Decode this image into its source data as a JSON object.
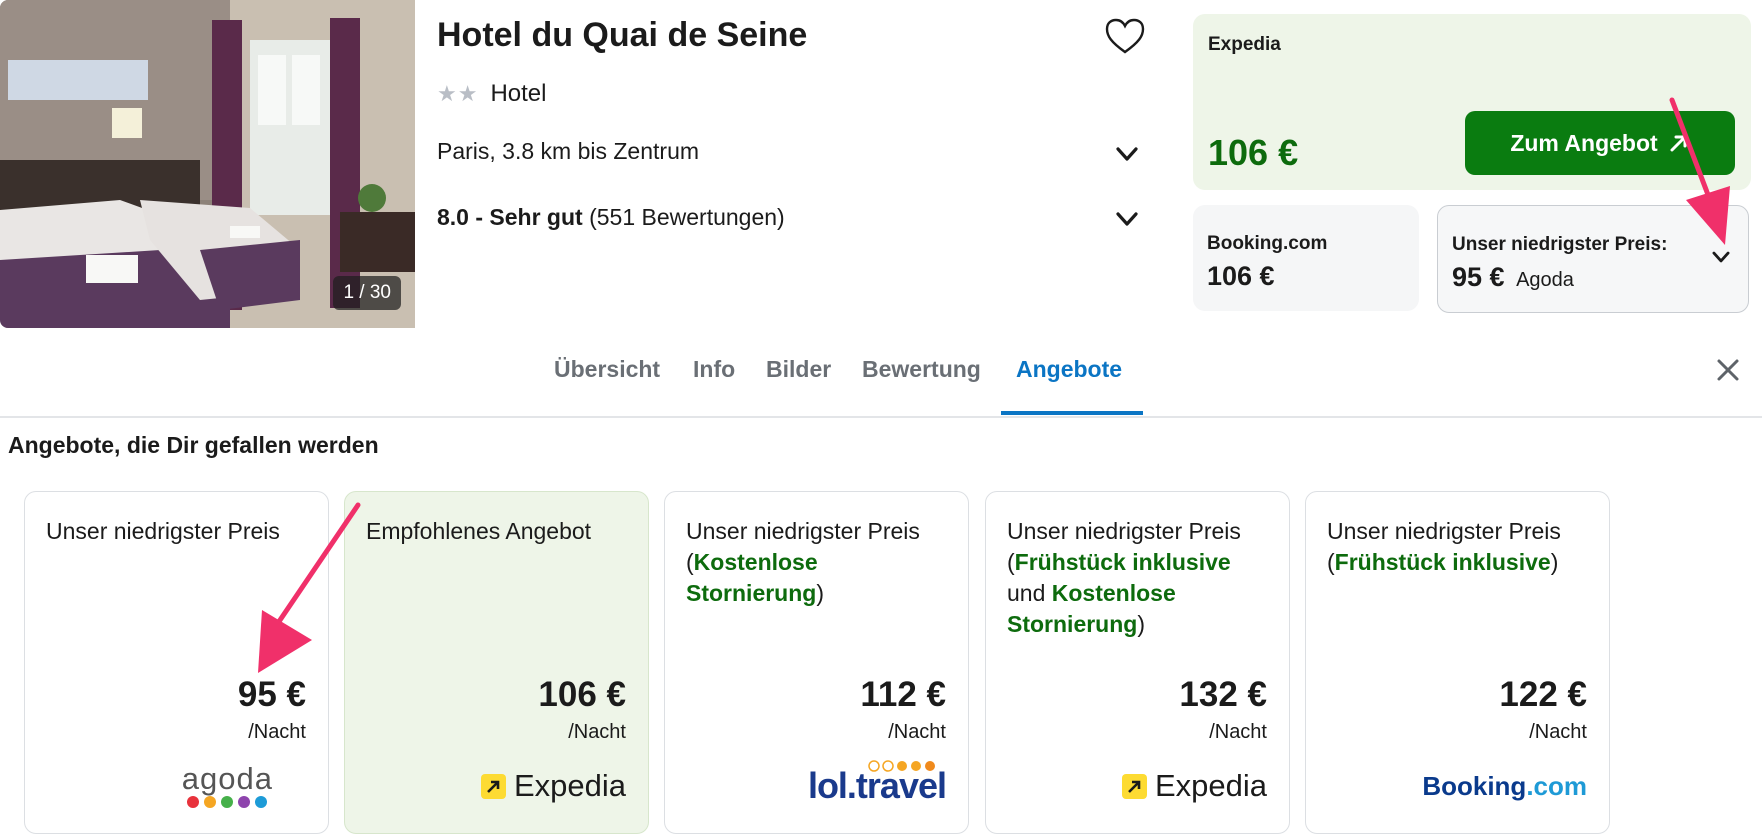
{
  "header": {
    "hotel_name": "Hotel du Quai de Seine",
    "stars": "★★",
    "type": "Hotel",
    "location": "Paris, 3.8 km bis Zentrum",
    "rating_score": "8.0 - Sehr gut",
    "rating_count": "(551 Bewertungen)",
    "photo_counter": "1 / 30"
  },
  "main_deal": {
    "provider": "Expedia",
    "price": "106 €",
    "button_label": "Zum Angebot",
    "button_icon": "external-arrow-icon"
  },
  "side_deals": [
    {
      "label": "Booking.com",
      "price": "106 €"
    },
    {
      "label": "Unser niedrigster Preis:",
      "price": "95 €",
      "provider": "Agoda"
    }
  ],
  "tabs": [
    {
      "label": "Übersicht"
    },
    {
      "label": "Info"
    },
    {
      "label": "Bilder"
    },
    {
      "label": "Bewertung"
    },
    {
      "label": "Angebote",
      "active": true
    }
  ],
  "section_title": "Angebote, die Dir gefallen werden",
  "cards": [
    {
      "title": "Unser niedrigster Preis",
      "price": "95 €",
      "per_night": "/Nacht",
      "provider_logo": "agoda"
    },
    {
      "title": "Empfohlenes Angebot",
      "price": "106 €",
      "per_night": "/Nacht",
      "provider_logo": "Expedia"
    },
    {
      "title_prefix": "Unser niedrigster Preis",
      "highlight_1": "Kostenlose Stornierung",
      "price": "112 €",
      "per_night": "/Nacht",
      "provider_logo": "lol.travel"
    },
    {
      "title_prefix": "Unser niedrigster Preis",
      "highlight_1": "Frühstück inklusive",
      "connector": "und",
      "highlight_2": "Kostenlose Stornierung",
      "price": "132 €",
      "per_night": "/Nacht",
      "provider_logo": "Expedia"
    },
    {
      "title_prefix": "Unser niedrigster Preis",
      "highlight_1": "Frühstück inklusive",
      "price": "122 €",
      "per_night": "/Nacht",
      "provider_logo_a": "Booking",
      "provider_logo_b": ".com"
    }
  ],
  "colors": {
    "accent_green": "#0a7c10",
    "deal_bg": "#eef5e8",
    "active_tab": "#0b75c4",
    "annotation_arrow": "#f0306a"
  }
}
